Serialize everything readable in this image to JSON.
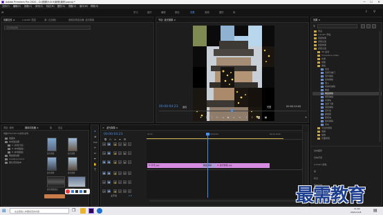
{
  "window": {
    "title": "Adobe Premiere Pro 2020 - D:\\视频\\9.8.9\\案例\\案例.prproj *",
    "controls": [
      "—",
      "☐",
      "✕"
    ]
  },
  "menu": [
    "文件(F)",
    "编辑(E)",
    "剪辑(C)",
    "序列(S)",
    "标记(M)",
    "图形(G)",
    "视图(V)",
    "窗口(W)",
    "帮助(H)"
  ],
  "workspaces": [
    "学习",
    "组件",
    "编辑",
    "颜色",
    "效果",
    "音频",
    "图形",
    "库"
  ],
  "active_workspace": "效果",
  "source_panel": {
    "tabs": [
      "效果控件 ≡",
      "Lumetri 范围",
      "源: (无剪辑)",
      "音频剪辑混合器: 波光粼粼"
    ],
    "search_placeholder": "(无剪辑选择)"
  },
  "program_monitor": {
    "tab": "节目: 波光粼粼 ≡",
    "timecode_current": "00:00:04:23",
    "fit_label": "适合",
    "quality_label": "完整",
    "timecode_duration": "00:00:10:00"
  },
  "effects_panel": {
    "tab": "效果 ≡",
    "search_placeholder": "",
    "items": [
      {
        "label": "预设",
        "type": "folder",
        "indent": 0
      },
      {
        "label": "Lumetri 预设",
        "type": "folder",
        "indent": 0
      },
      {
        "label": "音频效果",
        "type": "folder",
        "indent": 0
      },
      {
        "label": "音频过渡",
        "type": "folder",
        "indent": 0
      },
      {
        "label": "视频效果",
        "type": "folder",
        "indent": 0
      },
      {
        "label": "视频过渡",
        "type": "folder",
        "indent": 0
      },
      {
        "label": "3D 运动",
        "type": "folder",
        "indent": 1
      },
      {
        "label": "Immersive Video",
        "type": "folder",
        "indent": 1
      },
      {
        "label": "内滑",
        "type": "folder",
        "indent": 1
      },
      {
        "label": "划像",
        "type": "folder",
        "indent": 1
      },
      {
        "label": "擦除",
        "type": "folder",
        "indent": 1
      },
      {
        "label": "划出",
        "type": "item",
        "indent": 2
      },
      {
        "label": "双侧平推门",
        "type": "item",
        "indent": 2
      },
      {
        "label": "带状擦除",
        "type": "item",
        "indent": 2
      },
      {
        "label": "径向擦除",
        "type": "item",
        "indent": 2
      },
      {
        "label": "插入",
        "type": "item",
        "indent": 2
      },
      {
        "label": "时钟式擦除",
        "type": "item",
        "indent": 2
      },
      {
        "label": "棋盘",
        "type": "item",
        "indent": 2
      },
      {
        "label": "棋盘擦除",
        "type": "item",
        "indent": 2,
        "selected": true
      },
      {
        "label": "楔形擦除",
        "type": "item",
        "indent": 2
      },
      {
        "label": "水波块",
        "type": "item",
        "indent": 2
      },
      {
        "label": "油漆飞溅",
        "type": "item",
        "indent": 2
      },
      {
        "label": "渐变擦除",
        "type": "item",
        "indent": 2
      },
      {
        "label": "百叶窗",
        "type": "item",
        "indent": 2
      },
      {
        "label": "螺旋框",
        "type": "item",
        "indent": 2
      },
      {
        "label": "随机块",
        "type": "item",
        "indent": 2
      },
      {
        "label": "随机擦除",
        "type": "item",
        "indent": 2
      },
      {
        "label": "风车",
        "type": "item",
        "indent": 2
      },
      {
        "label": "沉浸式视频",
        "type": "folder",
        "indent": 1
      },
      {
        "label": "溶解",
        "type": "folder",
        "indent": 1
      },
      {
        "label": "缩放",
        "type": "folder",
        "indent": 1
      },
      {
        "label": "页面剥落",
        "type": "folder",
        "indent": 1
      }
    ],
    "bottom_panels": [
      "基本图形",
      "基本声音",
      "Lumetri 颜色",
      "库",
      "标记",
      "历史记录",
      "信息"
    ]
  },
  "project_panel": {
    "tabs": [
      "项目: 案例",
      "媒体浏览器 ≡",
      "库",
      "信息"
    ],
    "location": "电脑\\F8\\2020.8\\案例\\案例",
    "tree": [
      "收藏夹",
      "本地驱动器",
      "C (系统分区)",
      "D (本地磁盘)",
      "E (本地磁盘)",
      "网络驱动器",
      "Creative Cloud",
      "团队项目版本"
    ],
    "thumbs": [
      {
        "label": "波光粼粼"
      },
      {
        "label": "波光粼粼"
      },
      {
        "label": "波光粼粼"
      },
      {
        "label": "波光粼粼"
      },
      {
        "label": "波光粼粼素材"
      },
      {
        "label": "波光粼粼"
      }
    ]
  },
  "timeline": {
    "tab": "波光粼粼 ≡",
    "timecode": "00:00:04:23",
    "ruler_labels": [
      "00:00",
      "00:00:05:00",
      "00:00:10:00"
    ],
    "tracks": [
      "V3",
      "V2",
      "V1",
      "A1",
      "A2",
      "A3"
    ],
    "master_label": "主声道",
    "master_value": "0.0",
    "clips": [
      {
        "label": "fx 外景.jpg",
        "track": "V1"
      },
      {
        "label": "棋盘擦除",
        "track": "V1",
        "transition": true
      },
      {
        "label": "fx 波光粼粼.jpg",
        "track": "V1"
      }
    ]
  },
  "watermark": "最需教育",
  "taskbar": {
    "search_placeholder": "在这里输入你要搜索的内容",
    "time": "11:02",
    "date": "2021/11/8"
  },
  "colors": {
    "accent": "#4b8fe8",
    "clip": "#d48be0",
    "playhead": "#4b8fe8"
  }
}
